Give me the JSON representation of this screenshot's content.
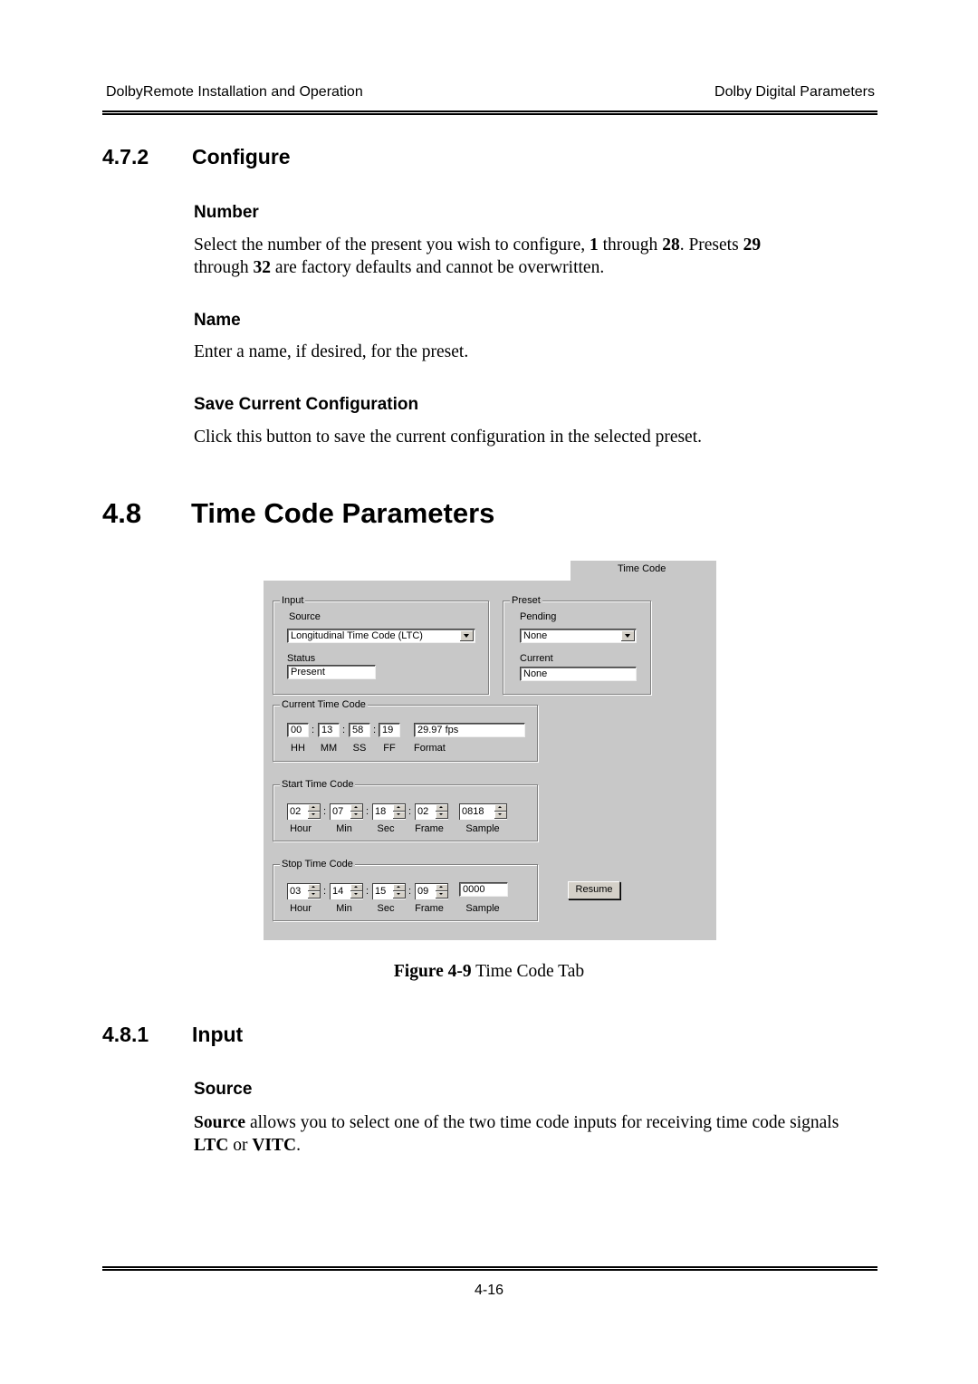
{
  "header": {
    "left": "DolbyRemote Installation and Operation",
    "right": "Dolby Digital Parameters"
  },
  "section_472": {
    "number": "4.7.2",
    "title": "Configure",
    "number_heading": "Number",
    "number_text_1": "Select the number of the present you wish to configure, ",
    "number_bold_1": "1",
    "number_text_2": " through ",
    "number_bold_2": "28",
    "number_text_3": ". Presets ",
    "number_bold_3": "29",
    "number_text_4": " through ",
    "number_bold_4": "32",
    "number_text_5": " are factory defaults and cannot be overwritten.",
    "name_heading": "Name",
    "name_text": "Enter a name, if desired, for the preset.",
    "save_heading": "Save Current Configuration",
    "save_text": "Click this button to save the current configuration in the selected preset."
  },
  "section_48": {
    "number": "4.8",
    "title": "Time Code Parameters"
  },
  "figure": {
    "tab_label": "Time Code",
    "input_group": {
      "legend": "Input",
      "source_label": "Source",
      "source_value": "Longitudinal Time Code (LTC)",
      "status_label": "Status",
      "status_value": "Present"
    },
    "preset_group": {
      "legend": "Preset",
      "pending_label": "Pending",
      "pending_value": "None",
      "current_label": "Current",
      "current_value": "None"
    },
    "current_tc": {
      "legend": "Current Time Code",
      "hh": "00",
      "mm": "13",
      "ss": "58",
      "ff": "19",
      "format": "29.97 fps",
      "labels": {
        "hh": "HH",
        "mm": "MM",
        "ss": "SS",
        "ff": "FF",
        "format": "Format"
      }
    },
    "start_tc": {
      "legend": "Start Time Code",
      "hour": "02",
      "min": "07",
      "sec": "18",
      "frame": "02",
      "sample": "0818",
      "labels": {
        "hour": "Hour",
        "min": "Min",
        "sec": "Sec",
        "frame": "Frame",
        "sample": "Sample"
      }
    },
    "stop_tc": {
      "legend": "Stop Time Code",
      "hour": "03",
      "min": "14",
      "sec": "15",
      "frame": "09",
      "sample": "0000",
      "labels": {
        "hour": "Hour",
        "min": "Min",
        "sec": "Sec",
        "frame": "Frame",
        "sample": "Sample"
      }
    },
    "resume_button": "Resume",
    "colon": ":"
  },
  "caption": {
    "bold": "Figure 4-9",
    "text": " Time Code Tab"
  },
  "section_481": {
    "number": "4.8.1",
    "title": "Input",
    "source_heading": "Source",
    "source_bold": "Source",
    "source_text_1": " allows you to select one of the two time code inputs for receiving time code signals ",
    "source_bold_2": "LTC",
    "source_text_2": " or ",
    "source_bold_3": "VITC",
    "source_text_3": "."
  },
  "footer": {
    "page": "4-16"
  }
}
